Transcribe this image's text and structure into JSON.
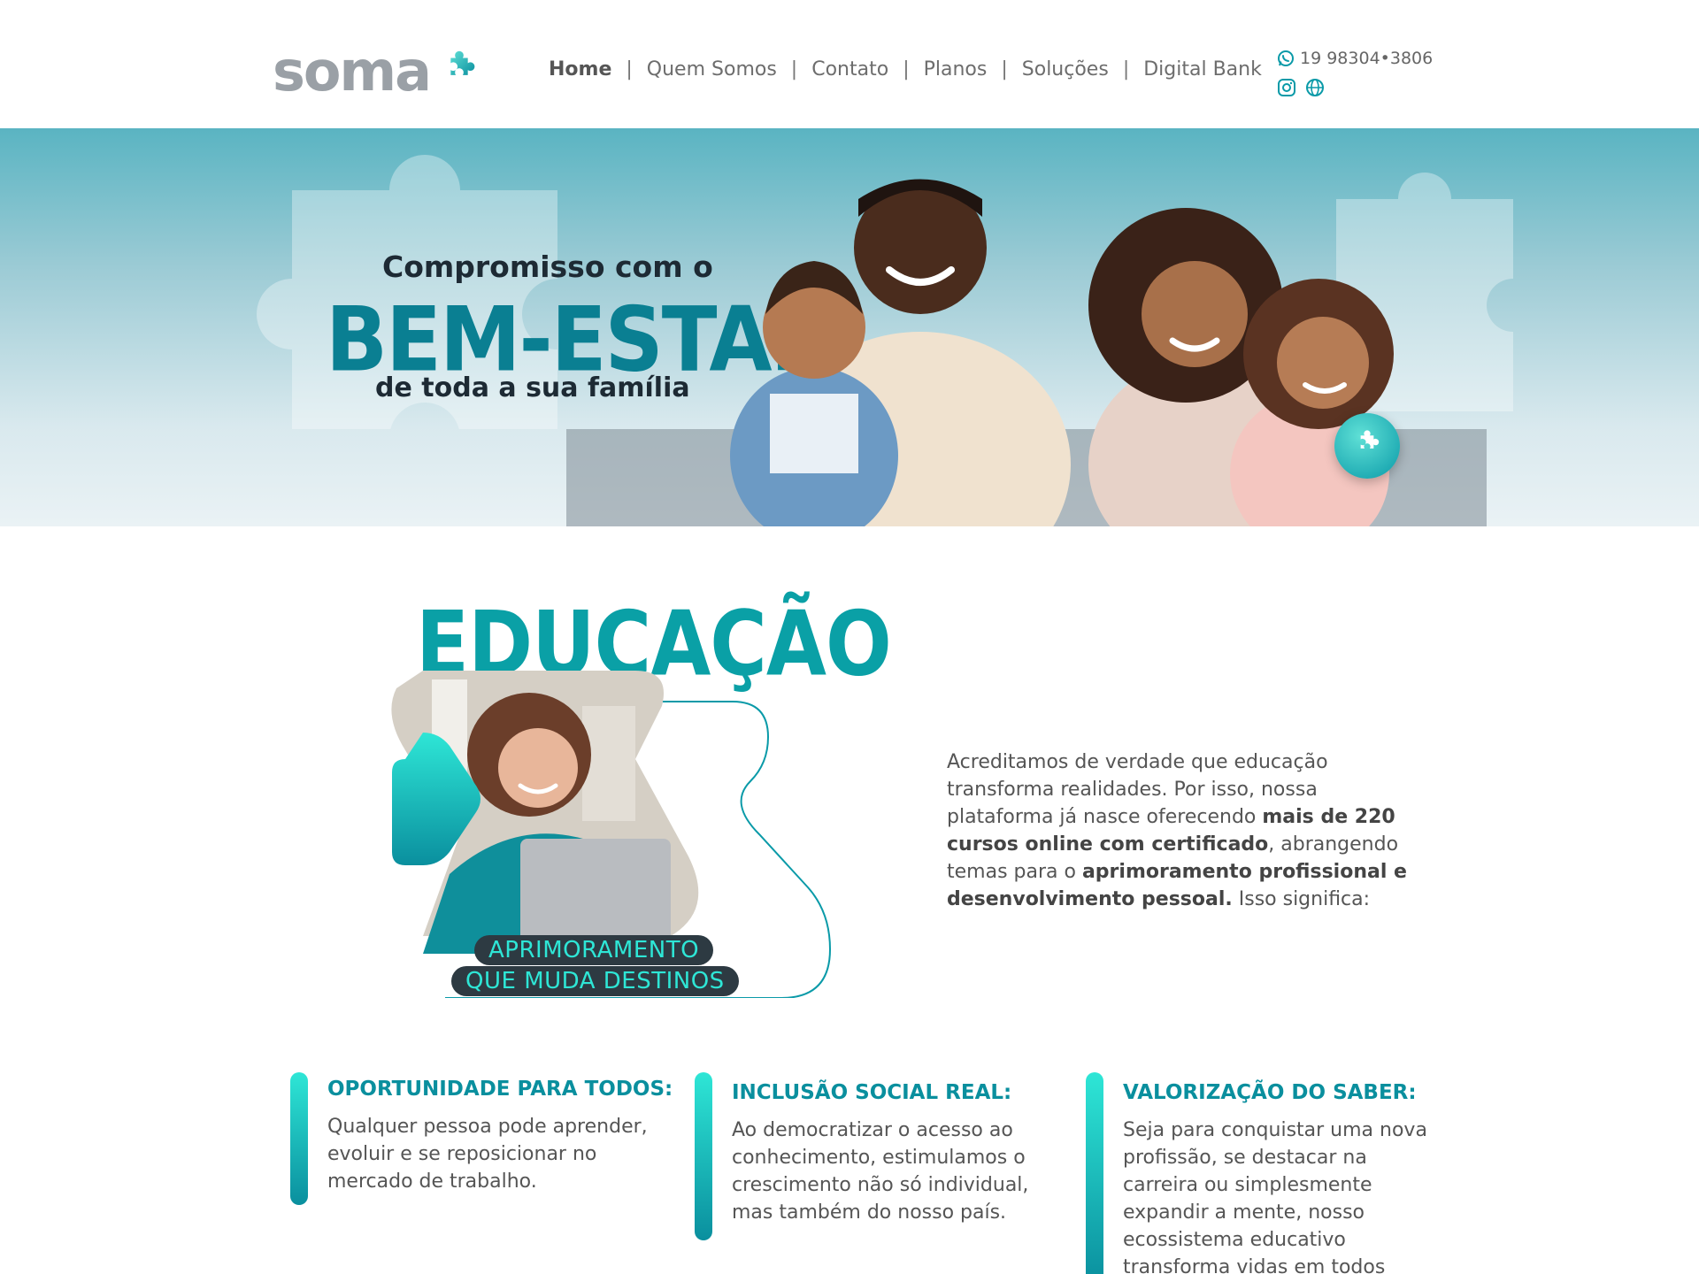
{
  "header": {
    "logo_text": "soma",
    "nav": [
      {
        "label": "Home",
        "active": true
      },
      {
        "label": "Quem Somos",
        "active": false
      },
      {
        "label": "Contato",
        "active": false
      },
      {
        "label": "Planos",
        "active": false
      },
      {
        "label": "Soluções",
        "active": false
      },
      {
        "label": "Digital Bank",
        "active": false
      }
    ],
    "separator": "|",
    "phone": "19 98304•3806",
    "icons": [
      "whatsapp-icon",
      "instagram-icon",
      "globe-icon"
    ]
  },
  "hero": {
    "line1": "Compromisso com o",
    "line2": "BEM-ESTAR",
    "line3": "de toda a sua família"
  },
  "education": {
    "title": "EDUCAÇÃO",
    "tag_line1": "APRIMORAMENTO",
    "tag_line2": "QUE MUDA DESTINOS",
    "paragraph_parts": [
      {
        "text": "Acreditamos de verdade que educação transforma realidades. Por isso, nossa plataforma já nasce oferecendo ",
        "bold": false
      },
      {
        "text": "mais de 220 cursos online com certificado",
        "bold": true
      },
      {
        "text": ", abrangendo temas para o ",
        "bold": false
      },
      {
        "text": "aprimoramento profissional e desenvolvimento pessoal.",
        "bold": true
      },
      {
        "text": " Isso significa:",
        "bold": false
      }
    ]
  },
  "features": [
    {
      "title": "OPORTUNIDADE PARA TODOS:",
      "body": "Qualquer pessoa pode aprender, evoluir e se reposicionar no mercado de trabalho."
    },
    {
      "title": "INCLUSÃO SOCIAL REAL:",
      "body": "Ao democratizar o acesso ao conhecimento, estimulamos o crescimento não só individual, mas também do nosso país."
    },
    {
      "title": "VALORIZAÇÃO DO SABER:",
      "body": "Seja para conquistar uma nova profissão, se destacar na carreira ou simplesmente expandir a mente, nosso ecossistema educativo transforma vidas em todos"
    }
  ],
  "colors": {
    "brand_teal": "#0a8f9e",
    "brand_aqua": "#2ee6d6",
    "dark": "#2d3a42",
    "logo_gray": "#9aa0a6"
  }
}
